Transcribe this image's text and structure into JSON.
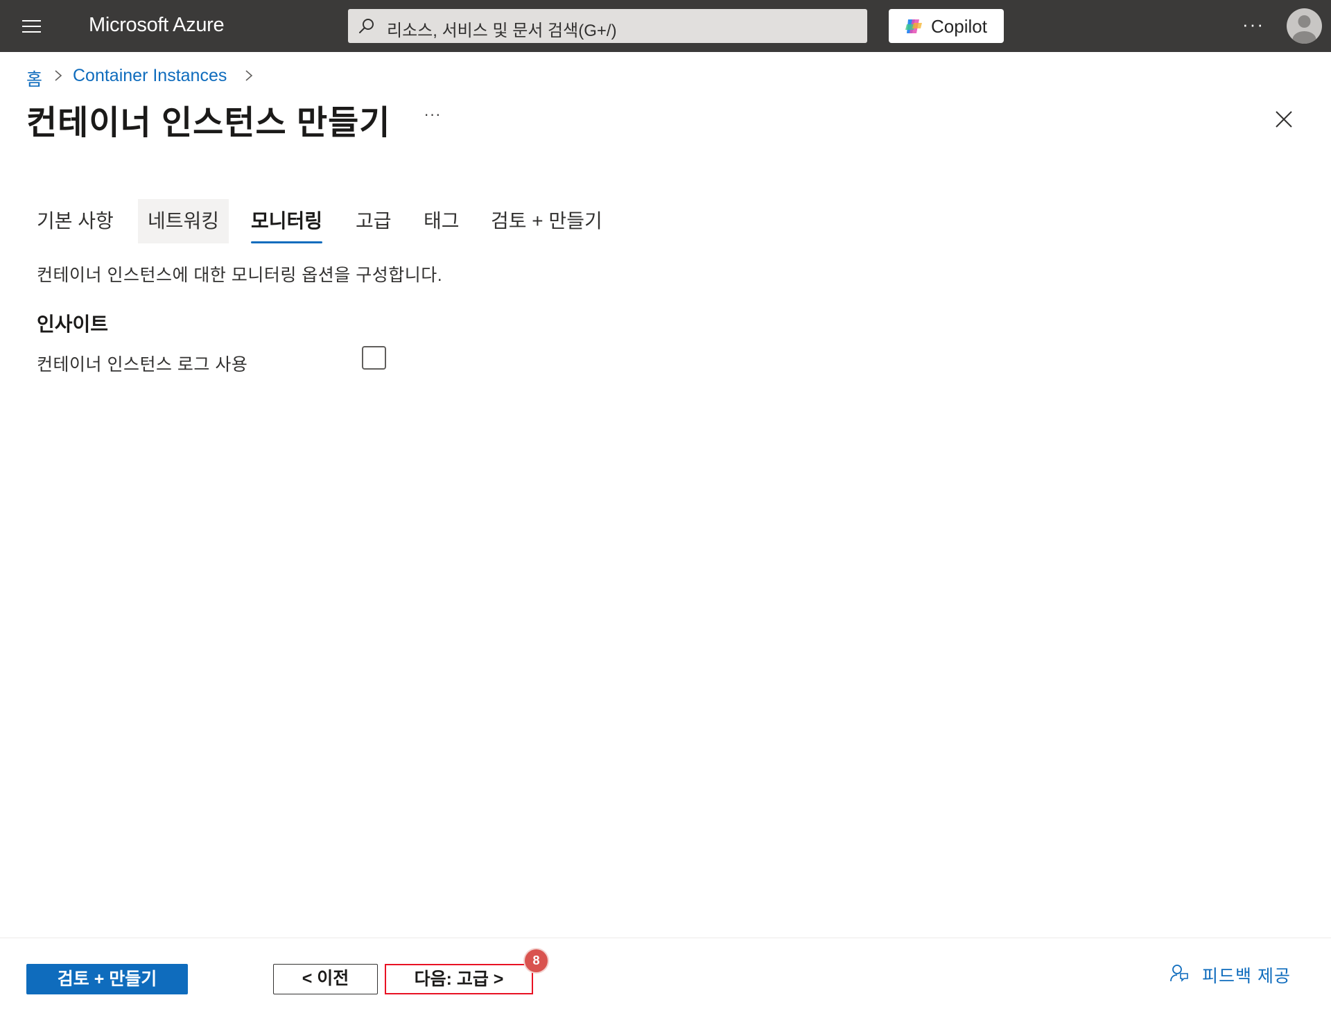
{
  "topbar": {
    "brand": "Microsoft Azure",
    "search_placeholder": "리소스, 서비스 및 문서 검색(G+/)",
    "copilot_label": "Copilot",
    "more_label": "···",
    "bg_color": "#3b3a39"
  },
  "breadcrumb": {
    "items": [
      {
        "label": "홈"
      },
      {
        "label": "Container Instances"
      }
    ]
  },
  "page": {
    "title": "컨테이너 인스턴스 만들기",
    "more_label": "···"
  },
  "tabs": [
    {
      "label": "기본 사항",
      "state": "normal"
    },
    {
      "label": "네트워킹",
      "state": "hover"
    },
    {
      "label": "모니터링",
      "state": "active"
    },
    {
      "label": "고급",
      "state": "normal"
    },
    {
      "label": "태그",
      "state": "normal"
    },
    {
      "label": "검토 + 만들기",
      "state": "normal"
    }
  ],
  "content": {
    "description": "컨테이너 인스턴스에 대한 모니터링 옵션을 구성합니다.",
    "section_title": "인사이트",
    "log_checkbox_label": "컨테이너 인스턴스 로그 사용",
    "log_checkbox_checked": false
  },
  "footer": {
    "review_create_label": "검토 + 만들기",
    "previous_label": "< 이전",
    "next_label": "다음: 고급 >",
    "next_badge": "8",
    "feedback_label": "피드백 제공"
  },
  "colors": {
    "accent": "#0f6cbd",
    "highlight_border": "#e81123",
    "badge": "#d9534f"
  }
}
